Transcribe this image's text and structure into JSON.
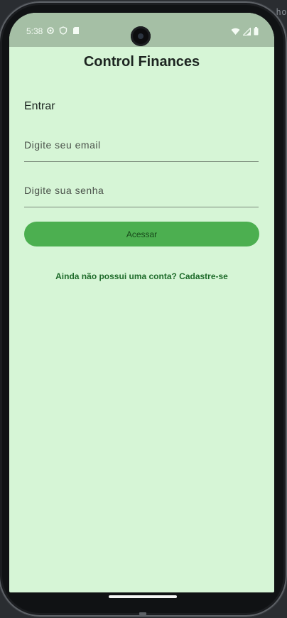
{
  "background": {
    "code_fragment": "--ho"
  },
  "status_bar": {
    "time": "5:38",
    "left_icons": [
      "settings-icon",
      "shield-icon",
      "sd-card-icon"
    ],
    "right_icons": [
      "wifi-icon",
      "signal-icon",
      "battery-icon"
    ]
  },
  "app": {
    "title": "Control Finances",
    "section_title": "Entrar",
    "email_placeholder": "Digite seu email",
    "password_placeholder": "Digite sua senha",
    "submit_label": "Acessar",
    "signup_link": "Ainda não possui uma conta? Cadastre-se"
  },
  "colors": {
    "background": "#d6f5d6",
    "status_bar": "#a5bfa5",
    "button": "#4caf50",
    "link": "#1e6b2a"
  }
}
